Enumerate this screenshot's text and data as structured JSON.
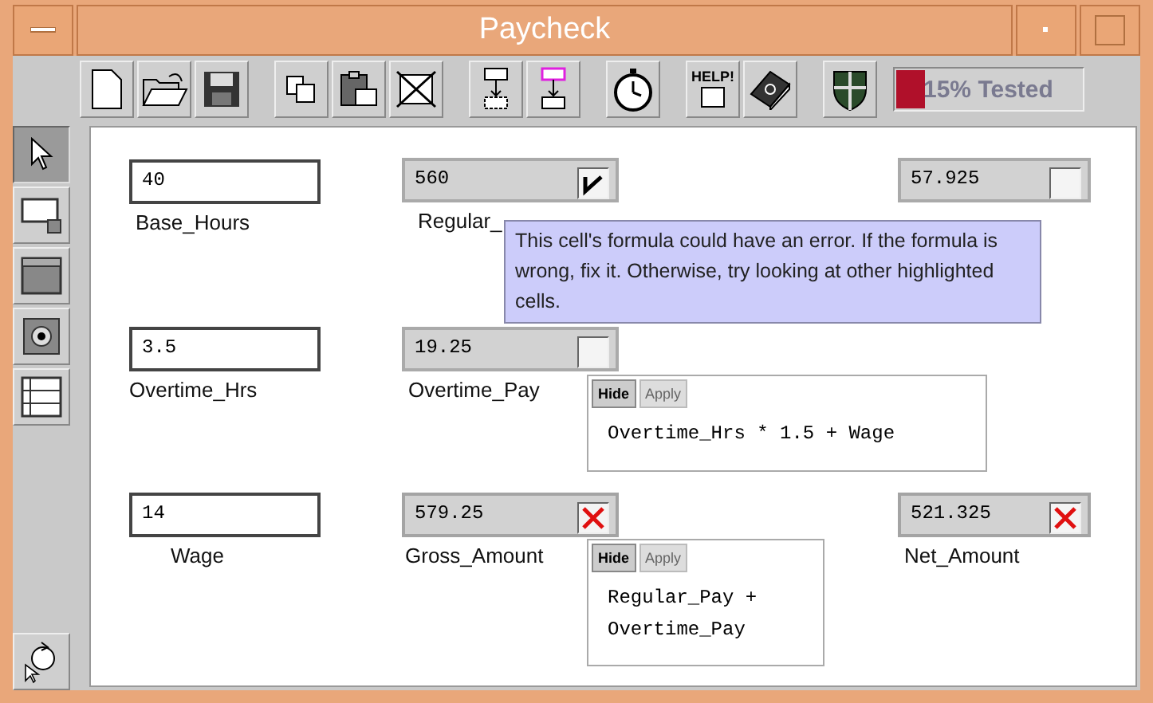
{
  "window": {
    "title": "Paycheck"
  },
  "toolbar": {
    "help_label": "HELP!",
    "progress": {
      "label": "15% Tested",
      "level": 0.15
    }
  },
  "palette": [
    {
      "kind": "pointer",
      "selected": true
    },
    {
      "kind": "input",
      "selected": false
    },
    {
      "kind": "output",
      "selected": false
    },
    {
      "kind": "target",
      "selected": false
    },
    {
      "kind": "table",
      "selected": false
    }
  ],
  "cells": [
    {
      "kind": "input",
      "value": "40",
      "label": "Base_Hours"
    },
    {
      "kind": "formula",
      "value": "560",
      "label": "Regular_",
      "checked": true,
      "error": false
    },
    {
      "kind": "formula",
      "value": "57.925",
      "checked": false,
      "error": false
    },
    {
      "kind": "input",
      "value": "3.5",
      "label": "Overtime_Hrs"
    },
    {
      "kind": "formula",
      "value": "19.25",
      "label": "Overtime_Pay",
      "checked": false,
      "error": false,
      "formula": {
        "hide_label": "Hide",
        "apply_label": "Apply",
        "apply_disabled": true,
        "lines": [
          "Overtime_Hrs * 1.5 + Wage"
        ]
      }
    },
    {
      "kind": "input",
      "value": "14",
      "label": "Wage"
    },
    {
      "kind": "formula",
      "value": "579.25",
      "label": "Gross_Amount",
      "error": true,
      "formula": {
        "hide_label": "Hide",
        "apply_label": "Apply",
        "apply_disabled": true,
        "lines": [
          "Regular_Pay +",
          "Overtime_Pay"
        ]
      }
    },
    {
      "kind": "formula",
      "value": "521.325",
      "label": "Net_Amount",
      "error": true
    }
  ],
  "tooltip": {
    "text": "This cell's formula could have an error. If the formula is wrong, fix it. Otherwise, try looking at other highlighted cells."
  }
}
